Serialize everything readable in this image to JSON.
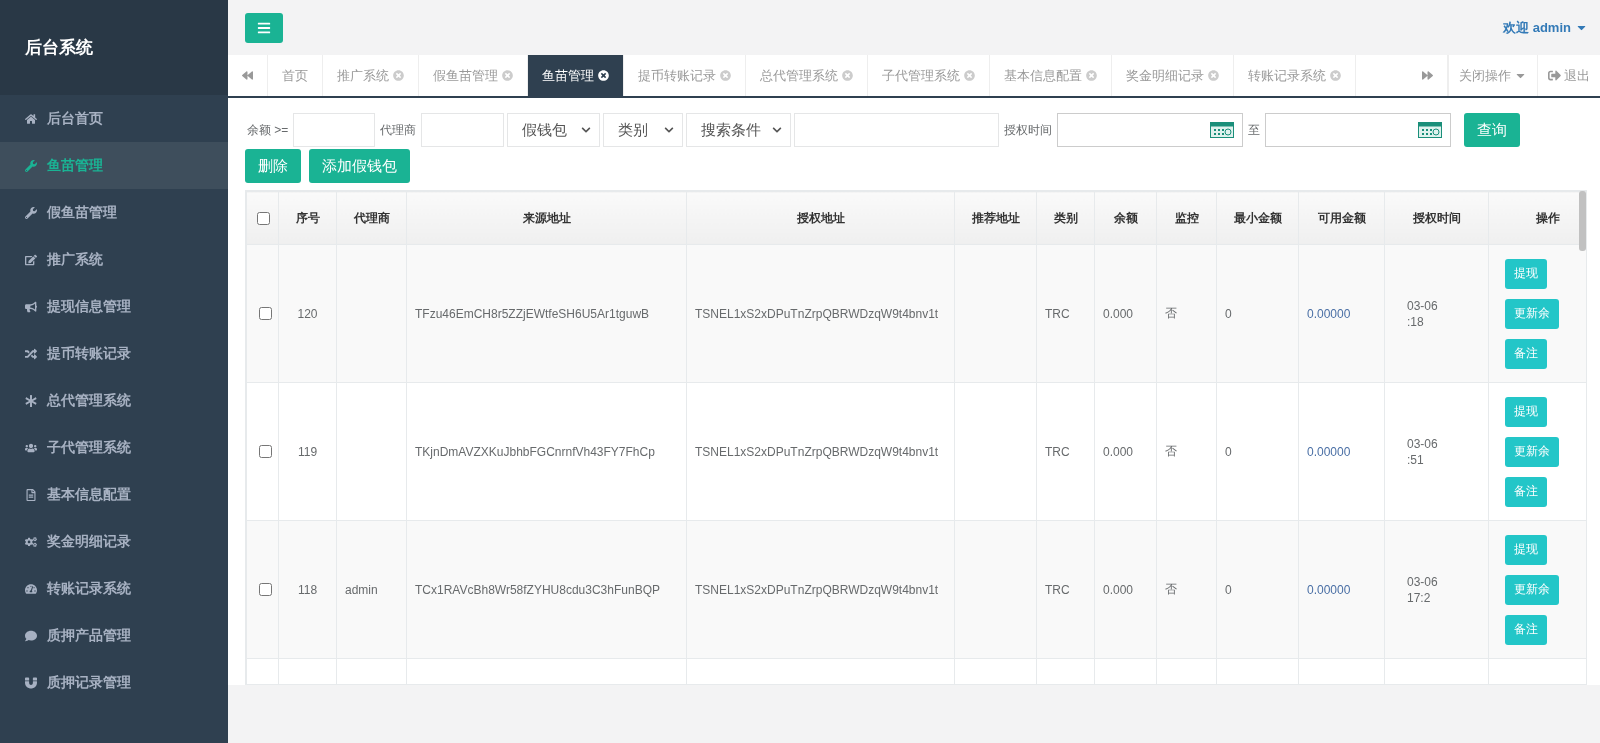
{
  "sidebar": {
    "title": "后台系统",
    "items": [
      {
        "label": "后台首页",
        "selected": false
      },
      {
        "label": "鱼苗管理",
        "selected": true
      },
      {
        "label": "假鱼苗管理",
        "selected": false
      },
      {
        "label": "推广系统",
        "selected": false
      },
      {
        "label": "提现信息管理",
        "selected": false
      },
      {
        "label": "提币转账记录",
        "selected": false
      },
      {
        "label": "总代管理系统",
        "selected": false
      },
      {
        "label": "子代管理系统",
        "selected": false
      },
      {
        "label": "基本信息配置",
        "selected": false
      },
      {
        "label": "奖金明细记录",
        "selected": false
      },
      {
        "label": "转账记录系统",
        "selected": false
      },
      {
        "label": "质押产品管理",
        "selected": false
      },
      {
        "label": "质押记录管理",
        "selected": false
      }
    ]
  },
  "topbar": {
    "welcome": "欢迎",
    "user": "admin"
  },
  "tabs": [
    {
      "label": "首页",
      "closable": false,
      "selected": false
    },
    {
      "label": "推广系统",
      "closable": true,
      "selected": false
    },
    {
      "label": "假鱼苗管理",
      "closable": true,
      "selected": false
    },
    {
      "label": "鱼苗管理",
      "closable": true,
      "selected": true
    },
    {
      "label": "提币转账记录",
      "closable": true,
      "selected": false
    },
    {
      "label": "总代管理系统",
      "closable": true,
      "selected": false
    },
    {
      "label": "子代管理系统",
      "closable": true,
      "selected": false
    },
    {
      "label": "基本信息配置",
      "closable": true,
      "selected": false
    },
    {
      "label": "奖金明细记录",
      "closable": true,
      "selected": false
    },
    {
      "label": "转账记录系统",
      "closable": true,
      "selected": false
    }
  ],
  "tab_actions": {
    "close_menu": "关闭操作",
    "logout": "退出"
  },
  "filters": {
    "balance_label": "余额 >=",
    "agent_label": "代理商",
    "selects": [
      "假钱包",
      "类别",
      "搜索条件"
    ],
    "time_label": "授权时间",
    "to_label": "至",
    "query_button": "查询"
  },
  "buttons": [
    "删除",
    "添加假钱包"
  ],
  "table": {
    "all_checked": false,
    "columns": [
      "序号",
      "代理商",
      "来源地址",
      "授权地址",
      "推荐地址",
      "类别",
      "余额",
      "监控",
      "最小金额",
      "可用金额",
      "授权时间",
      "操作"
    ],
    "rows": [
      {
        "checked": false,
        "id": "120",
        "agent": "",
        "source": "TFzu46EmCH8r5ZZjEWtfeSH6U5Ar1tguwB",
        "auth": "TSNEL1xS2xDPuTnZrpQBRWDzqW9t4bnv1t",
        "type": "TRC",
        "balance": "0.000",
        "monitor": "否",
        "min": "0",
        "available": "0.00000",
        "date": "03-06",
        "clock": ":18",
        "actions": [
          "提现",
          "更新余",
          "备注"
        ]
      },
      {
        "checked": false,
        "id": "119",
        "agent": "",
        "source": "TKjnDmAVZXKuJbhbFGCnrnfVh43FY7FhCp",
        "auth": "TSNEL1xS2xDPuTnZrpQBRWDzqW9t4bnv1t",
        "type": "TRC",
        "balance": "0.000",
        "monitor": "否",
        "min": "0",
        "available": "0.00000",
        "date": "03-06",
        "clock": ":51",
        "actions": [
          "提现",
          "更新余",
          "备注"
        ]
      },
      {
        "checked": false,
        "id": "118",
        "agent": "admin",
        "source": "TCx1RAVcBh8Wr58fZYHU8cdu3C3hFunBQP",
        "auth": "TSNEL1xS2xDPuTnZrpQBRWDzqW9t4bnv1t",
        "type": "TRC",
        "balance": "0.000",
        "monitor": "否",
        "min": "0",
        "available": "0.00000",
        "date": "03-06",
        "clock": "17:2",
        "actions": [
          "提现",
          "更新余",
          "备注"
        ]
      }
    ]
  }
}
